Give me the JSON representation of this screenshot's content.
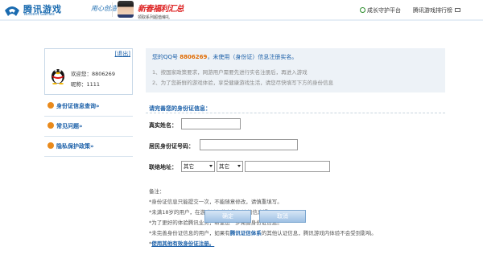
{
  "header": {
    "logo_cn": "腾讯游戏",
    "logo_en": "Tencent Games",
    "slogan": "用心创造快乐",
    "promo_title": "新春福利汇总",
    "promo_sub": "领取系列超值壕礼",
    "guardian": "成长守护平台",
    "ranking": "腾讯游戏排行榜"
  },
  "sidebar": {
    "logout": "[退出]",
    "welcome": "欢迎您：8806269",
    "nickname": "昵称：1111",
    "nav": [
      "身份证信息查询»",
      "常见问题»",
      "隐私保护政策»"
    ]
  },
  "notice": {
    "title_pre": "您的QQ号",
    "qq": "8806269",
    "title_post": "，未使用（身份证）信息注册实名。",
    "line1": "1、按国家政策要求，网游用户需要先进行实名注册后，再进入游戏",
    "line2": "2、为了您新鲜的游戏体验，享受健康游戏生活，请您尽快填写下方的身份信息"
  },
  "form": {
    "section_title": "请完善您的身份证信息：",
    "name_label": "真实姓名：",
    "id_label": "居民身份证号码：",
    "address_label": "联络地址：",
    "province": "其它",
    "city": "其它"
  },
  "notes": {
    "title": "备注：",
    "n1": "*身份证信息只能提交一次，不能随意修改，请慎重填写。",
    "n2": "*未满18岁的用户，在游戏过程将有防沉迷的信息提示。",
    "n3": "*为了更好的体验腾讯业务，希望进一步完善身份证信息。",
    "n4_pre": "*未完善身份证信息的用户，如果有",
    "n4_hl": "腾讯证信体系",
    "n4_post": "的其他认证信息，腾讯游戏内体验不会受到影响。",
    "n5_pre": "*",
    "n5_link": "使用其他有效身份证注册。"
  },
  "buttons": {
    "confirm": "确定",
    "cancel": "取消"
  }
}
